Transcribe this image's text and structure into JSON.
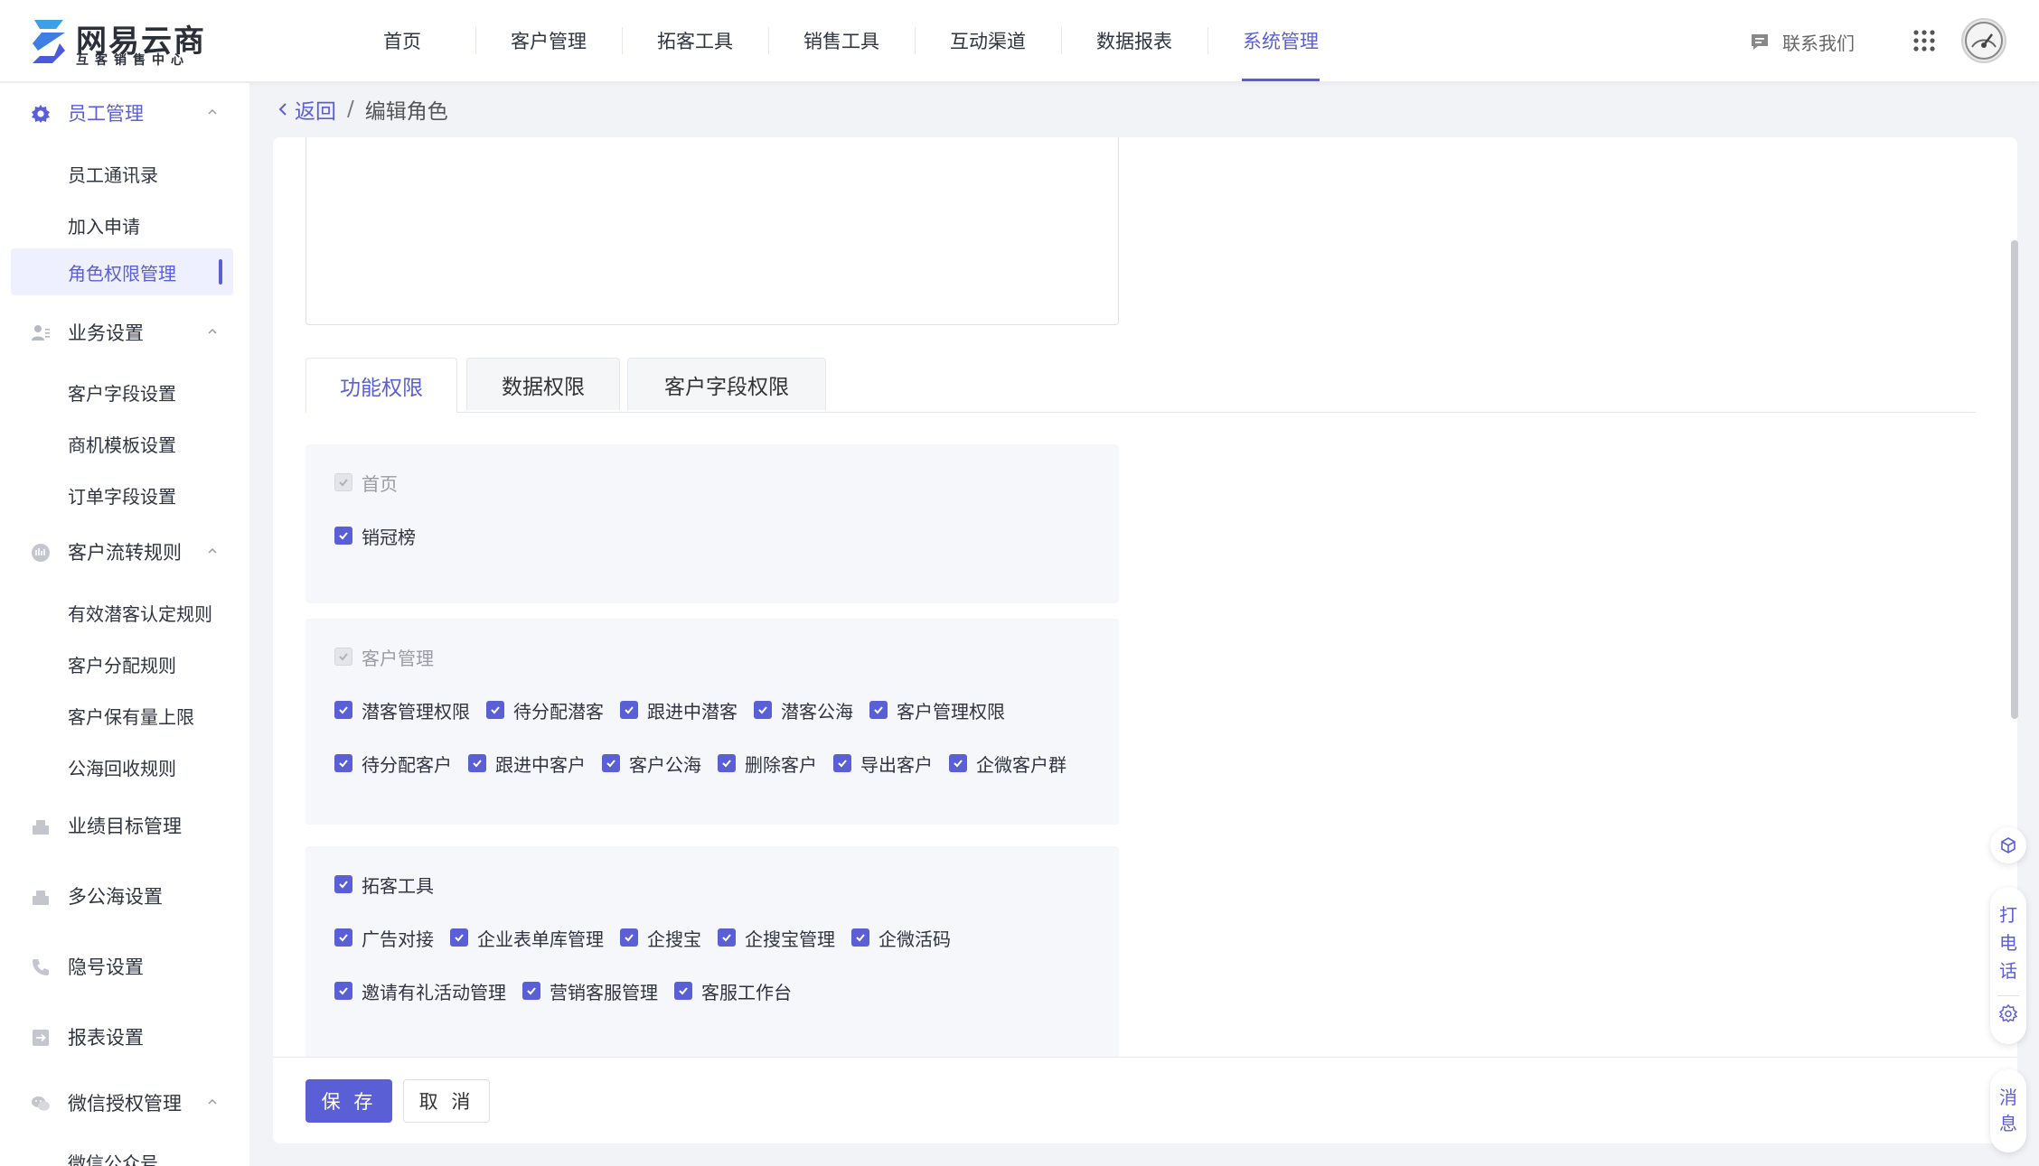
{
  "brand": {
    "name": "网易云商",
    "subtitle": "互客销售中心"
  },
  "topnav": {
    "items": [
      "首页",
      "客户管理",
      "拓客工具",
      "销售工具",
      "互动渠道",
      "数据报表",
      "系统管理"
    ],
    "active": "系统管理",
    "contact": "联系我们"
  },
  "sidebar": {
    "groups": [
      {
        "label": "员工管理",
        "icon": "gear-icon",
        "expanded": true,
        "items": [
          "员工通讯录",
          "加入申请",
          "角色权限管理"
        ]
      },
      {
        "label": "业务设置",
        "icon": "user-settings-icon",
        "expanded": true,
        "items": [
          "客户字段设置",
          "商机模板设置",
          "订单字段设置"
        ]
      },
      {
        "label": "客户流转规则",
        "icon": "flow-icon",
        "expanded": true,
        "items": [
          "有效潜客认定规则",
          "客户分配规则",
          "客户保有量上限",
          "公海回收规则"
        ]
      },
      {
        "label": "业绩目标管理",
        "icon": "target-icon"
      },
      {
        "label": "多公海设置",
        "icon": "sea-icon"
      },
      {
        "label": "隐号设置",
        "icon": "phone-icon"
      },
      {
        "label": "报表设置",
        "icon": "report-icon"
      },
      {
        "label": "微信授权管理",
        "icon": "wechat-icon",
        "expanded": true,
        "items": [
          "微信公众号"
        ]
      }
    ],
    "active_item": "角色权限管理"
  },
  "breadcrumb": {
    "back": "返回",
    "separator": "/",
    "current": "编辑角色"
  },
  "tabs": [
    "功能权限",
    "数据权限",
    "客户字段权限"
  ],
  "active_tab": "功能权限",
  "sections": [
    {
      "header": "首页",
      "header_disabled": true,
      "rows": [
        [
          "销冠榜"
        ]
      ]
    },
    {
      "header": "客户管理",
      "header_disabled": true,
      "rows": [
        [
          "潜客管理权限",
          "待分配潜客",
          "跟进中潜客",
          "潜客公海",
          "客户管理权限"
        ],
        [
          "待分配客户",
          "跟进中客户",
          "客户公海",
          "删除客户",
          "导出客户",
          "企微客户群"
        ]
      ]
    },
    {
      "header": "拓客工具",
      "header_disabled": false,
      "rows": [
        [
          "广告对接",
          "企业表单库管理",
          "企搜宝",
          "企搜宝管理",
          "企微活码"
        ],
        [
          "邀请有礼活动管理",
          "营销客服管理",
          "客服工作台"
        ]
      ]
    }
  ],
  "buttons": {
    "save": "保 存",
    "cancel": "取 消"
  },
  "floating": {
    "call": "打电话",
    "message": "消息"
  },
  "colors": {
    "accent": "#5b5fd6",
    "active_bg": "#eef0ff",
    "section_bg": "#f6f7fa"
  }
}
